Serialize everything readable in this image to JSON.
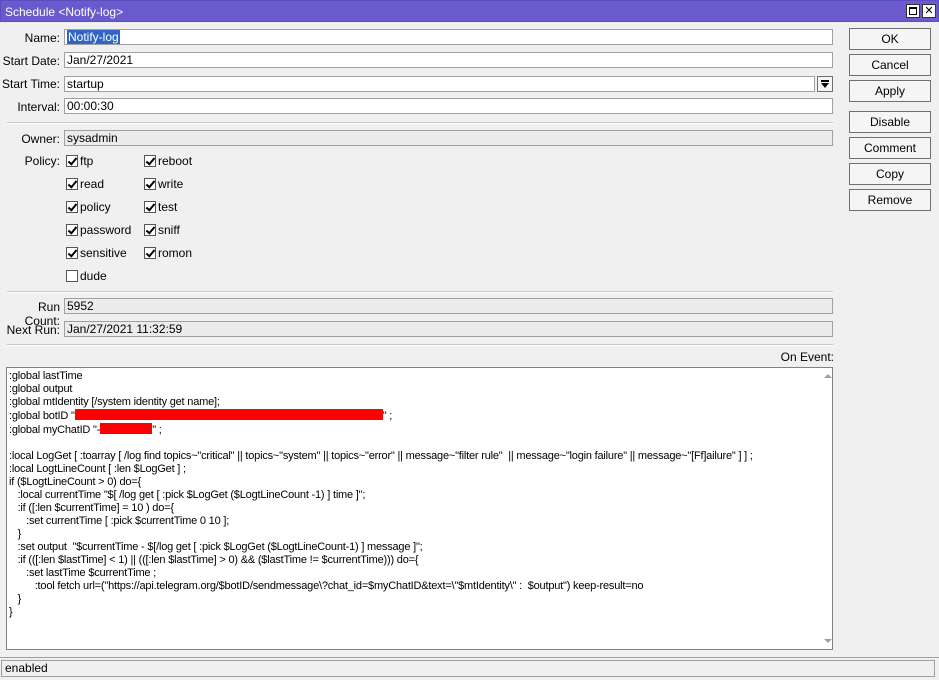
{
  "window": {
    "title": "Schedule <Notify-log>",
    "maximize_icon": "maximize-icon",
    "close_label": "✕"
  },
  "form": {
    "name_label": "Name:",
    "name_value": "Notify-log",
    "start_date_label": "Start Date:",
    "start_date_value": "Jan/27/2021",
    "start_time_label": "Start Time:",
    "start_time_value": "startup",
    "interval_label": "Interval:",
    "interval_value": "00:00:30",
    "owner_label": "Owner:",
    "owner_value": "sysadmin",
    "policy_label": "Policy:",
    "run_count_label": "Run Count:",
    "run_count_value": "5952",
    "next_run_label": "Next Run:",
    "next_run_value": "Jan/27/2021 11:32:59",
    "on_event_label": "On Event:"
  },
  "policies": {
    "left": [
      {
        "label": "ftp",
        "checked": true
      },
      {
        "label": "read",
        "checked": true
      },
      {
        "label": "policy",
        "checked": true
      },
      {
        "label": "password",
        "checked": true
      },
      {
        "label": "sensitive",
        "checked": true
      },
      {
        "label": "dude",
        "checked": false
      }
    ],
    "right": [
      {
        "label": "reboot",
        "checked": true
      },
      {
        "label": "write",
        "checked": true
      },
      {
        "label": "test",
        "checked": true
      },
      {
        "label": "sniff",
        "checked": true
      },
      {
        "label": "romon",
        "checked": true
      }
    ]
  },
  "buttons": {
    "ok": "OK",
    "cancel": "Cancel",
    "apply": "Apply",
    "disable": "Disable",
    "comment": "Comment",
    "copy": "Copy",
    "remove": "Remove"
  },
  "script": {
    "l1": ":global lastTime",
    "l2": ":global output",
    "l3": ":global mtIdentity [/system identity get name];",
    "l4a": ":global botID \"",
    "l4b": "\" ;",
    "l5a": ":global myChatID \"-",
    "l5b": "\" ;",
    "l6": ":local LogGet [ :toarray [ /log find topics~\"critical\" || topics~\"system\" || topics~\"error\" || message~\"filter rule\"  || message~\"login failure\" || message~\"[Ff]ailure\" ] ] ;",
    "l7": ":local LogtLineCount [ :len $LogGet ] ;",
    "l8": "if ($LogtLineCount > 0) do={",
    "l9": "   :local currentTime \"$[ /log get [ :pick $LogGet ($LogtLineCount -1) ] time ]\";",
    "l10": "   :if ([:len $currentTime] = 10 ) do={",
    "l11": "      :set currentTime [ :pick $currentTime 0 10 ];",
    "l12": "   }",
    "l13": "   :set output  \"$currentTime - $[/log get [ :pick $LogGet ($LogtLineCount-1) ] message ]\";",
    "l14": "   :if (([:len $lastTime] < 1) || (([:len $lastTime] > 0) && ($lastTime != $currentTime))) do={",
    "l15": "      :set lastTime $currentTime ;",
    "l16": "         :tool fetch url=(\"https://api.telegram.org/$botID/sendmessage\\?chat_id=$myChatID&text=\\\"$mtIdentity\\\" :  $output\") keep-result=no",
    "l17": "   }",
    "l18": "}"
  },
  "status": {
    "text": "enabled"
  },
  "colors": {
    "titlebar": "#6a5acd",
    "selection": "#3165c4",
    "redaction": "#ff0000"
  }
}
